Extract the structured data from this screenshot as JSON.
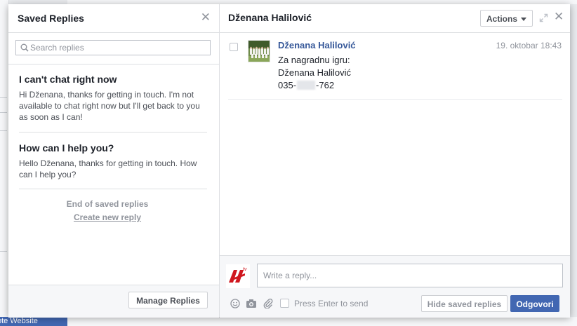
{
  "background": {
    "bottom_bar_text": "ote Website"
  },
  "saved_replies": {
    "title": "Saved Replies",
    "search_placeholder": "Search replies",
    "items": [
      {
        "title": "I can't chat right now",
        "body": "Hi Dženana, thanks for getting in touch. I'm not available to chat right now but I'll get back to you as soon as I can!"
      },
      {
        "title": "How can I help you?",
        "body": "Hello Dženana, thanks for getting in touch. How can I help you?"
      }
    ],
    "end_text": "End of saved replies",
    "create_link": "Create new reply",
    "manage_button": "Manage Replies"
  },
  "conversation": {
    "title": "Dženana Halilović",
    "actions_button": "Actions",
    "message": {
      "sender": "Dženana Halilović",
      "time": "19. oktobar 18:43",
      "line1": "Za nagradnu igru:",
      "line2": "Dženana Halilović",
      "phone_prefix": "035-",
      "phone_suffix": "-762"
    },
    "composer": {
      "placeholder": "Write a reply...",
      "enter_label": "Press Enter to send",
      "hide_button": "Hide saved replies",
      "send_button": "Odgovori"
    }
  },
  "colors": {
    "brand_blue": "#4267b2",
    "link_blue": "#365899",
    "logo_red": "#d0171e"
  }
}
